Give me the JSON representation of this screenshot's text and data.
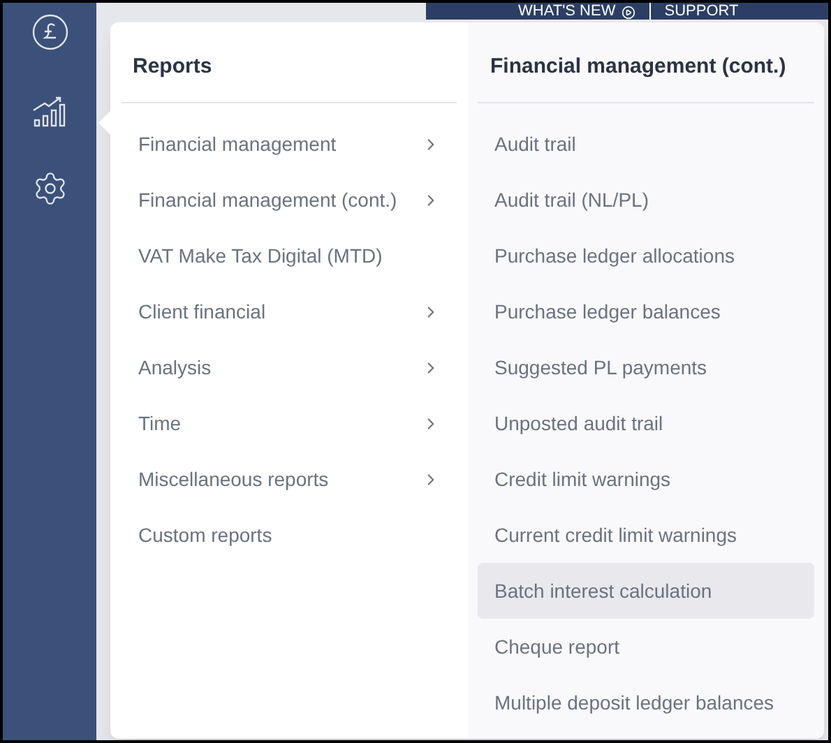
{
  "top_bar": {
    "links": [
      "WHAT'S NEW",
      "SUPPORT"
    ]
  },
  "menu": {
    "heading": "Reports",
    "items": [
      {
        "label": "Financial management",
        "has_submenu": true
      },
      {
        "label": "Financial management (cont.)",
        "has_submenu": true
      },
      {
        "label": "VAT Make Tax Digital (MTD)",
        "has_submenu": false
      },
      {
        "label": "Client financial",
        "has_submenu": true
      },
      {
        "label": "Analysis",
        "has_submenu": true
      },
      {
        "label": "Time",
        "has_submenu": true
      },
      {
        "label": "Miscellaneous reports",
        "has_submenu": true
      },
      {
        "label": "Custom reports",
        "has_submenu": false
      }
    ]
  },
  "submenu": {
    "heading": "Financial management (cont.)",
    "items": [
      {
        "label": "Audit trail",
        "selected": false
      },
      {
        "label": "Audit trail (NL/PL)",
        "selected": false
      },
      {
        "label": "Purchase ledger allocations",
        "selected": false
      },
      {
        "label": "Purchase ledger balances",
        "selected": false
      },
      {
        "label": "Suggested PL payments",
        "selected": false
      },
      {
        "label": "Unposted audit trail",
        "selected": false
      },
      {
        "label": "Credit limit warnings",
        "selected": false
      },
      {
        "label": "Current credit limit warnings",
        "selected": false
      },
      {
        "label": "Batch interest calculation",
        "selected": true
      },
      {
        "label": "Cheque report",
        "selected": false
      },
      {
        "label": "Multiple deposit ledger balances",
        "selected": false
      }
    ]
  }
}
